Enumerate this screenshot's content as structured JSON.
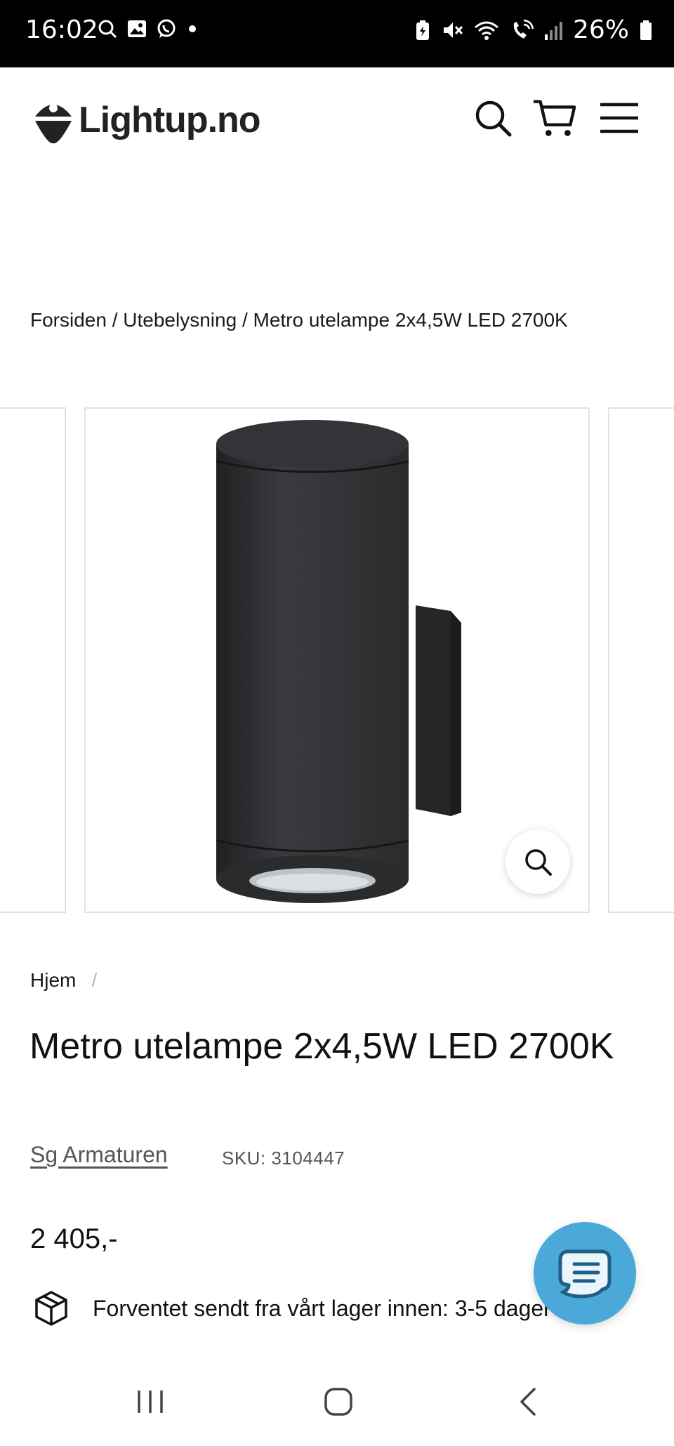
{
  "status_bar": {
    "time": "16:02",
    "battery": "26%",
    "left_icons": [
      "search-icon",
      "gallery-icon",
      "whatsapp-icon",
      "dot-icon"
    ],
    "right_icons": [
      "battery-saver-icon",
      "mute-icon",
      "wifi-icon",
      "wifi-call-icon",
      "signal-icon",
      "battery-icon"
    ]
  },
  "header": {
    "logo_text": "Lightup.no",
    "icons": [
      "search-icon",
      "cart-icon",
      "menu-icon"
    ]
  },
  "breadcrumb_top": {
    "items": [
      "Forsiden",
      "Utebelysning",
      "Metro utelampe 2x4,5W LED 2700K"
    ],
    "separator": "/"
  },
  "product": {
    "breadcrumb": {
      "home": "Hjem",
      "separator": "/"
    },
    "title": "Metro utelampe 2x4,5W LED 2700K",
    "vendor": "Sg Armaturen",
    "sku": "SKU: 3104447",
    "price": "2 405,-",
    "shipping_text": "Forventet sendt fra vårt lager innen: 3-5 dager"
  },
  "colors": {
    "accent_chat": "#4aa9d9",
    "gallery_border": "#e6e1d8",
    "lamp": "#2e2f31"
  },
  "nav_bar": {
    "buttons": [
      "recent-apps-icon",
      "home-icon",
      "back-icon"
    ]
  }
}
